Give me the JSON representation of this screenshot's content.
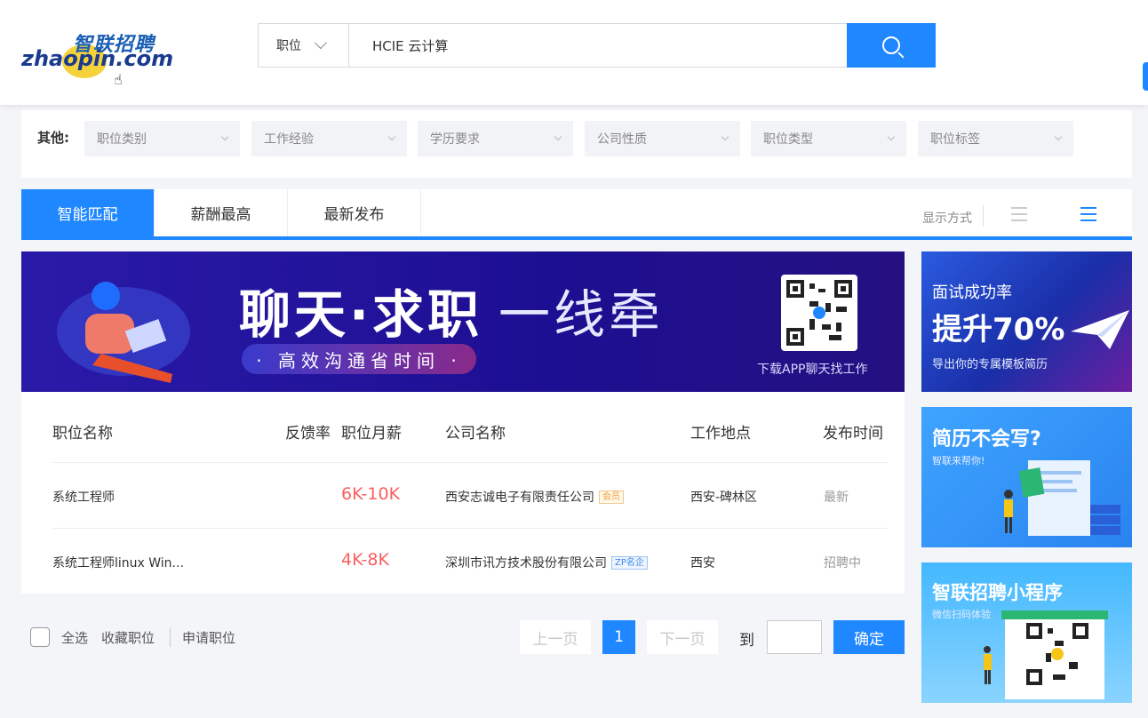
{
  "header": {
    "logo_cn": "智联招聘",
    "logo_en": "zhaopin.com",
    "search_type": "职位",
    "search_value": "HCIE 云计算"
  },
  "filters": {
    "label": "其他:",
    "items": [
      "职位类别",
      "工作经验",
      "学历要求",
      "公司性质",
      "职位类型",
      "职位标签"
    ]
  },
  "tabs": {
    "items": [
      "智能匹配",
      "薪酬最高",
      "最新发布"
    ],
    "display_label": "显示方式"
  },
  "banner": {
    "title_bold": "聊天·求职",
    "title_light": "一线牵",
    "pill": "· 高效沟通省时间 ·",
    "qr_caption": "下载APP聊天找工作"
  },
  "table": {
    "headers": [
      "职位名称",
      "反馈率",
      "职位月薪",
      "公司名称",
      "工作地点",
      "发布时间"
    ],
    "rows": [
      {
        "title": "系统工程师",
        "salary": "6K-10K",
        "company": "西安志诚电子有限责任公司",
        "badge": "会员",
        "location": "西安-碑林区",
        "time": "最新"
      },
      {
        "title": "系统工程师linux Win...",
        "salary": "4K-8K",
        "company": "深圳市讯方技术股份有限公司",
        "badge": "ZP名企",
        "location": "西安",
        "time": "招聘中"
      }
    ]
  },
  "bottom": {
    "select_all": "全选",
    "collect": "收藏职位",
    "apply": "申请职位",
    "prev": "上一页",
    "page": "1",
    "next": "下一页",
    "goto": "到",
    "confirm": "确定"
  },
  "ads": {
    "ad1": {
      "line1": "面试成功率",
      "big": "提升70%",
      "line3": "导出你的专属模板简历"
    },
    "ad2": {
      "big": "简历不会写?",
      "line2": "智联来帮你!"
    },
    "ad3": {
      "big": "智联招聘小程序",
      "line2": "微信扫码体验"
    }
  },
  "colors": {
    "accent": "#1f87ff",
    "salary": "#fa5f5f"
  }
}
